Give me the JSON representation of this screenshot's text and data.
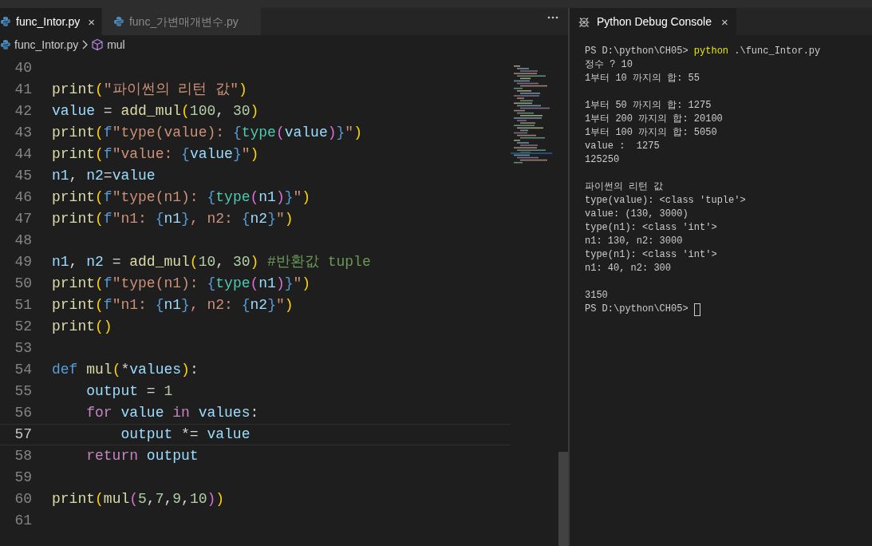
{
  "editor": {
    "tabs": [
      {
        "label": "func_Intor.py",
        "selected": true,
        "close": "×"
      },
      {
        "label": "func_가변매개변수.py",
        "selected": false
      }
    ],
    "breadcrumb": {
      "file": "func_Intor.py",
      "symbol": "mul"
    },
    "lines": [
      {
        "number": "40",
        "current": false
      },
      {
        "number": "41",
        "current": false,
        "tokens": [
          {
            "kind": "fn",
            "text": "print"
          },
          {
            "kind": "b1",
            "text": "("
          },
          {
            "kind": "str",
            "text": "\"파이썬의 리턴 값\""
          },
          {
            "kind": "b1",
            "text": ")"
          }
        ]
      },
      {
        "number": "42",
        "current": false,
        "tokens": [
          {
            "kind": "var",
            "text": "value"
          },
          {
            "kind": "op",
            "text": " = "
          },
          {
            "kind": "fn",
            "text": "add_mul"
          },
          {
            "kind": "b1",
            "text": "("
          },
          {
            "kind": "num",
            "text": "100"
          },
          {
            "kind": "op",
            "text": ", "
          },
          {
            "kind": "num",
            "text": "30"
          },
          {
            "kind": "b1",
            "text": ")"
          }
        ]
      },
      {
        "number": "43",
        "current": false,
        "tokens": [
          {
            "kind": "fn",
            "text": "print"
          },
          {
            "kind": "b1",
            "text": "("
          },
          {
            "kind": "def",
            "text": "f"
          },
          {
            "kind": "str",
            "text": "\"type(value): "
          },
          {
            "kind": "brace",
            "text": "{"
          },
          {
            "kind": "cls",
            "text": "type"
          },
          {
            "kind": "b2",
            "text": "("
          },
          {
            "kind": "var",
            "text": "value"
          },
          {
            "kind": "b2",
            "text": ")"
          },
          {
            "kind": "brace",
            "text": "}"
          },
          {
            "kind": "str",
            "text": "\""
          },
          {
            "kind": "b1",
            "text": ")"
          }
        ]
      },
      {
        "number": "44",
        "current": false,
        "tokens": [
          {
            "kind": "fn",
            "text": "print"
          },
          {
            "kind": "b1",
            "text": "("
          },
          {
            "kind": "def",
            "text": "f"
          },
          {
            "kind": "str",
            "text": "\"value: "
          },
          {
            "kind": "brace",
            "text": "{"
          },
          {
            "kind": "var",
            "text": "value"
          },
          {
            "kind": "brace",
            "text": "}"
          },
          {
            "kind": "str",
            "text": "\""
          },
          {
            "kind": "b1",
            "text": ")"
          }
        ]
      },
      {
        "number": "45",
        "current": false,
        "tokens": [
          {
            "kind": "var",
            "text": "n1"
          },
          {
            "kind": "op",
            "text": ", "
          },
          {
            "kind": "var",
            "text": "n2"
          },
          {
            "kind": "op",
            "text": "="
          },
          {
            "kind": "var",
            "text": "value"
          }
        ]
      },
      {
        "number": "46",
        "current": false,
        "tokens": [
          {
            "kind": "fn",
            "text": "print"
          },
          {
            "kind": "b1",
            "text": "("
          },
          {
            "kind": "def",
            "text": "f"
          },
          {
            "kind": "str",
            "text": "\"type(n1): "
          },
          {
            "kind": "brace",
            "text": "{"
          },
          {
            "kind": "cls",
            "text": "type"
          },
          {
            "kind": "b2",
            "text": "("
          },
          {
            "kind": "var",
            "text": "n1"
          },
          {
            "kind": "b2",
            "text": ")"
          },
          {
            "kind": "brace",
            "text": "}"
          },
          {
            "kind": "str",
            "text": "\""
          },
          {
            "kind": "b1",
            "text": ")"
          }
        ]
      },
      {
        "number": "47",
        "current": false,
        "tokens": [
          {
            "kind": "fn",
            "text": "print"
          },
          {
            "kind": "b1",
            "text": "("
          },
          {
            "kind": "def",
            "text": "f"
          },
          {
            "kind": "str",
            "text": "\"n1: "
          },
          {
            "kind": "brace",
            "text": "{"
          },
          {
            "kind": "var",
            "text": "n1"
          },
          {
            "kind": "brace",
            "text": "}"
          },
          {
            "kind": "str",
            "text": ", n2: "
          },
          {
            "kind": "brace",
            "text": "{"
          },
          {
            "kind": "var",
            "text": "n2"
          },
          {
            "kind": "brace",
            "text": "}"
          },
          {
            "kind": "str",
            "text": "\""
          },
          {
            "kind": "b1",
            "text": ")"
          }
        ]
      },
      {
        "number": "48",
        "current": false
      },
      {
        "number": "49",
        "current": false,
        "tokens": [
          {
            "kind": "var",
            "text": "n1"
          },
          {
            "kind": "op",
            "text": ", "
          },
          {
            "kind": "var",
            "text": "n2"
          },
          {
            "kind": "op",
            "text": " = "
          },
          {
            "kind": "fn",
            "text": "add_mul"
          },
          {
            "kind": "b1",
            "text": "("
          },
          {
            "kind": "num",
            "text": "10"
          },
          {
            "kind": "op",
            "text": ", "
          },
          {
            "kind": "num",
            "text": "30"
          },
          {
            "kind": "b1",
            "text": ")"
          },
          {
            "kind": "comment",
            "text": " #반환값 tuple"
          }
        ]
      },
      {
        "number": "50",
        "current": false,
        "tokens": [
          {
            "kind": "fn",
            "text": "print"
          },
          {
            "kind": "b1",
            "text": "("
          },
          {
            "kind": "def",
            "text": "f"
          },
          {
            "kind": "str",
            "text": "\"type(n1): "
          },
          {
            "kind": "brace",
            "text": "{"
          },
          {
            "kind": "cls",
            "text": "type"
          },
          {
            "kind": "b2",
            "text": "("
          },
          {
            "kind": "var",
            "text": "n1"
          },
          {
            "kind": "b2",
            "text": ")"
          },
          {
            "kind": "brace",
            "text": "}"
          },
          {
            "kind": "str",
            "text": "\""
          },
          {
            "kind": "b1",
            "text": ")"
          }
        ]
      },
      {
        "number": "51",
        "current": false,
        "tokens": [
          {
            "kind": "fn",
            "text": "print"
          },
          {
            "kind": "b1",
            "text": "("
          },
          {
            "kind": "def",
            "text": "f"
          },
          {
            "kind": "str",
            "text": "\"n1: "
          },
          {
            "kind": "brace",
            "text": "{"
          },
          {
            "kind": "var",
            "text": "n1"
          },
          {
            "kind": "brace",
            "text": "}"
          },
          {
            "kind": "str",
            "text": ", n2: "
          },
          {
            "kind": "brace",
            "text": "{"
          },
          {
            "kind": "var",
            "text": "n2"
          },
          {
            "kind": "brace",
            "text": "}"
          },
          {
            "kind": "str",
            "text": "\""
          },
          {
            "kind": "b1",
            "text": ")"
          }
        ]
      },
      {
        "number": "52",
        "current": false,
        "tokens": [
          {
            "kind": "fn",
            "text": "print"
          },
          {
            "kind": "b1",
            "text": "()"
          }
        ]
      },
      {
        "number": "53",
        "current": false
      },
      {
        "number": "54",
        "current": false,
        "tokens": [
          {
            "kind": "def",
            "text": "def "
          },
          {
            "kind": "fn",
            "text": "mul"
          },
          {
            "kind": "b1",
            "text": "("
          },
          {
            "kind": "op",
            "text": "*"
          },
          {
            "kind": "var",
            "text": "values"
          },
          {
            "kind": "b1",
            "text": ")"
          },
          {
            "kind": "op",
            "text": ":"
          }
        ]
      },
      {
        "number": "55",
        "current": false,
        "tokens": [
          {
            "kind": "var",
            "text": "    output"
          },
          {
            "kind": "op",
            "text": " = "
          },
          {
            "kind": "num",
            "text": "1"
          }
        ]
      },
      {
        "number": "56",
        "current": false,
        "tokens": [
          {
            "kind": "kw",
            "text": "    for "
          },
          {
            "kind": "var",
            "text": "value "
          },
          {
            "kind": "kw",
            "text": "in "
          },
          {
            "kind": "var",
            "text": "values"
          },
          {
            "kind": "op",
            "text": ":"
          }
        ]
      },
      {
        "number": "57",
        "current": true,
        "tokens": [
          {
            "kind": "var",
            "text": "        output"
          },
          {
            "kind": "op",
            "text": " *= "
          },
          {
            "kind": "var",
            "text": "value"
          }
        ]
      },
      {
        "number": "58",
        "current": false,
        "tokens": [
          {
            "kind": "kw",
            "text": "    return "
          },
          {
            "kind": "var",
            "text": "output"
          }
        ]
      },
      {
        "number": "59",
        "current": false
      },
      {
        "number": "60",
        "current": false,
        "tokens": [
          {
            "kind": "fn",
            "text": "print"
          },
          {
            "kind": "b1",
            "text": "("
          },
          {
            "kind": "fn",
            "text": "mul"
          },
          {
            "kind": "b2",
            "text": "("
          },
          {
            "kind": "num",
            "text": "5"
          },
          {
            "kind": "op",
            "text": ","
          },
          {
            "kind": "num",
            "text": "7"
          },
          {
            "kind": "op",
            "text": ","
          },
          {
            "kind": "num",
            "text": "9"
          },
          {
            "kind": "op",
            "text": ","
          },
          {
            "kind": "num",
            "text": "10"
          },
          {
            "kind": "b2",
            "text": ")"
          },
          {
            "kind": "b1",
            "text": ")"
          }
        ]
      },
      {
        "number": "61",
        "current": false
      }
    ]
  },
  "console": {
    "tab": {
      "label": "Python Debug Console",
      "selected": true,
      "close": "×"
    },
    "blocks": [
      [
        {
          "segments": [
            {
              "kind": "plain",
              "text": "PS D:\\python\\CH05> "
            },
            {
              "kind": "command",
              "text": "python"
            },
            {
              "kind": "plain",
              "text": " .\\func_Intor.py"
            }
          ]
        },
        {
          "text": "정수 ? 10"
        },
        {
          "text": "1부터 10 까지의 합: 55"
        }
      ],
      [
        {
          "text": "1부터 50 까지의 합: 1275"
        },
        {
          "text": "1부터 200 까지의 합: 20100"
        },
        {
          "text": "1부터 100 까지의 합: 5050"
        },
        {
          "text": "value :  1275"
        },
        {
          "text": "125250"
        }
      ],
      [
        {
          "text": "파이썬의 리턴 값"
        },
        {
          "text": "type(value): <class 'tuple'>"
        },
        {
          "text": "value: (130, 3000)"
        },
        {
          "text": "type(n1): <class 'int'>"
        },
        {
          "text": "n1: 130, n2: 3000"
        },
        {
          "text": "type(n1): <class 'int'>"
        },
        {
          "text": "n1: 40, n2: 300"
        }
      ],
      [
        {
          "text": "3150"
        },
        {
          "text": "PS D:\\python\\CH05> ",
          "cursor": true
        }
      ]
    ]
  }
}
